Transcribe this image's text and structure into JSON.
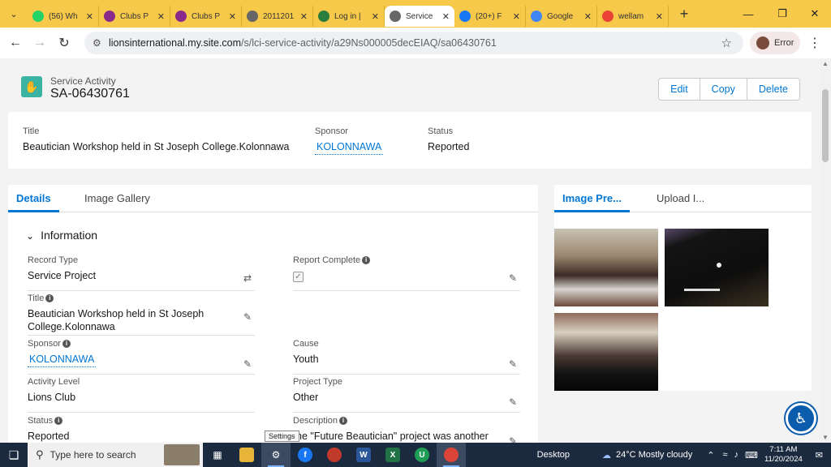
{
  "browser": {
    "tabs": [
      {
        "label": "(56) Wh",
        "fav": "whatsapp-icon",
        "color": "#25d366"
      },
      {
        "label": "Clubs P",
        "fav": "lions-icon",
        "color": "#8a2a8a"
      },
      {
        "label": "Clubs P",
        "fav": "lions-icon",
        "color": "#8a2a8a"
      },
      {
        "label": "2011201",
        "fav": "globe-icon",
        "color": "#666666"
      },
      {
        "label": "Log in |",
        "fav": "lions-logo-icon",
        "color": "#2a7d3c"
      },
      {
        "label": "Service",
        "fav": "globe-icon",
        "color": "#666666"
      },
      {
        "label": "(20+) F",
        "fav": "facebook-icon",
        "color": "#1877f2"
      },
      {
        "label": "Google",
        "fav": "google-translate-icon",
        "color": "#4285f4"
      },
      {
        "label": "wellam",
        "fav": "google-icon",
        "color": "#ea4335"
      }
    ],
    "url_host": "lionsinternational.my.site.com",
    "url_path": "/s/lci-service-activity/a29Ns000005decEIAQ/sa06430761",
    "profile_label": "Error"
  },
  "record": {
    "object_label": "Service Activity",
    "name": "SA-06430761",
    "actions": {
      "edit": "Edit",
      "copy": "Copy",
      "delete": "Delete"
    }
  },
  "highlights": {
    "title_label": "Title",
    "title_value": "Beautician Workshop held in St Joseph College.Kolonnawa",
    "sponsor_label": "Sponsor",
    "sponsor_value": "KOLONNAWA",
    "status_label": "Status",
    "status_value": "Reported"
  },
  "main_tabs": {
    "details": "Details",
    "gallery": "Image Gallery"
  },
  "section_title": "Information",
  "fields": {
    "record_type_label": "Record Type",
    "record_type_value": "Service Project",
    "report_complete_label": "Report Complete",
    "report_complete_checked": true,
    "title_label": "Title",
    "title_value": "Beautician Workshop held in St Joseph College.Kolonnawa",
    "sponsor_label": "Sponsor",
    "sponsor_value": "KOLONNAWA",
    "cause_label": "Cause",
    "cause_value": "Youth",
    "activity_level_label": "Activity Level",
    "activity_level_value": "Lions Club",
    "project_type_label": "Project Type",
    "project_type_value": "Other",
    "status_label": "Status",
    "status_value": "Reported",
    "description_label": "Description",
    "description_value": "he \"Future Beautician\" project was another"
  },
  "side_tabs": {
    "preview": "Image Pre...",
    "upload": "Upload I..."
  },
  "taskbar": {
    "search_placeholder": "Type here to search",
    "tooltip": "Settings",
    "desktop_label": "Desktop",
    "weather": "24°C  Mostly cloudy",
    "time": "7:11 AM",
    "date": "11/20/2024"
  }
}
